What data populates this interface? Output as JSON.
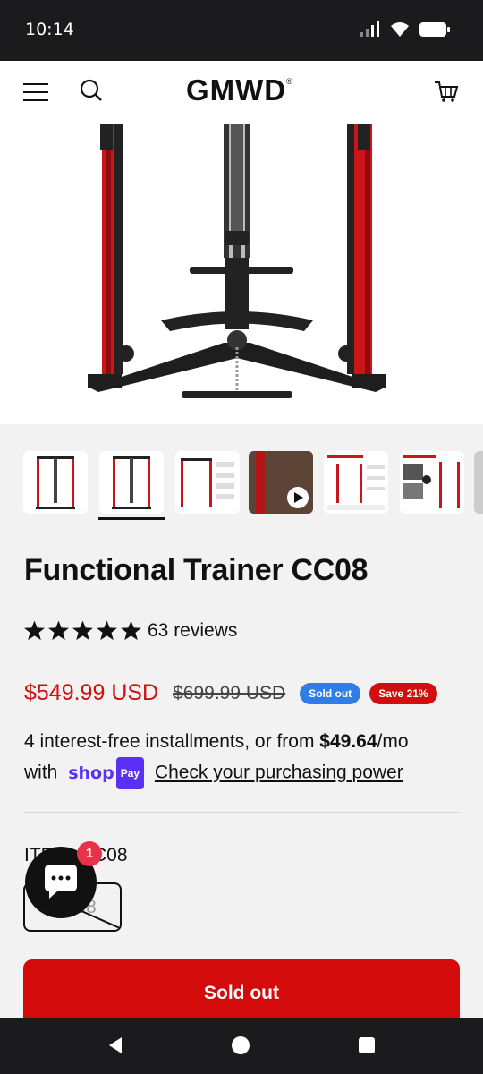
{
  "status_bar": {
    "time": "10:14"
  },
  "header": {
    "logo": "GMWD",
    "logo_mark": "®"
  },
  "product": {
    "title": "Functional Trainer CC08",
    "rating_stars": 5,
    "reviews": "63 reviews",
    "price": "$549.99 USD",
    "compare_price": "$699.99 USD",
    "badge_soldout": "Sold out",
    "badge_save": "Save 21%",
    "installments_prefix": "4 interest-free installments, or from ",
    "installments_amount": "$49.64",
    "installments_suffix": "/mo",
    "with": "with",
    "shop_pay_shop": "shop",
    "shop_pay_pay": "Pay",
    "purchasing_power_link": "Check your purchasing power",
    "item_label": "ITEM: CC08",
    "variant": "CC08",
    "sold_out_button": "Sold out"
  },
  "chat": {
    "unread": "1"
  },
  "colors": {
    "accent_red": "#d40b0b",
    "price_red": "#d10f0f",
    "soldout_blue": "#2f7ee8",
    "shop_pay": "#5a31f4"
  }
}
